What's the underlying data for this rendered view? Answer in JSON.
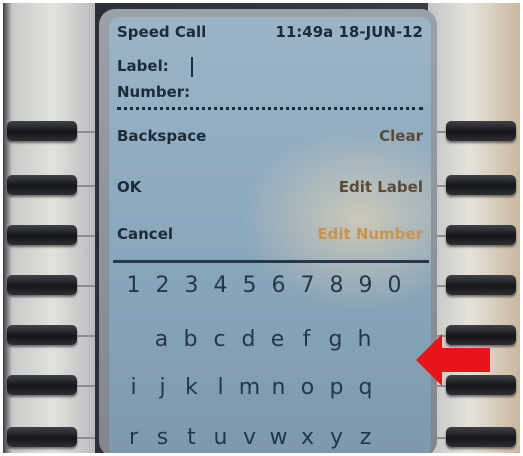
{
  "screen": {
    "title": "Speed Call",
    "clock": "11:49a 18-JUN-12",
    "label_field_name": "Label:",
    "label_value": "",
    "number_field_name": "Number:",
    "number_value": ""
  },
  "softkeys": {
    "backspace": "Backspace",
    "clear": "Clear",
    "ok": "OK",
    "edit_label": "Edit Label",
    "cancel": "Cancel",
    "edit_number": "Edit Number"
  },
  "keypad": {
    "digits": [
      "1",
      "2",
      "3",
      "4",
      "5",
      "6",
      "7",
      "8",
      "9",
      "0"
    ],
    "row_a": [
      "a",
      "b",
      "c",
      "d",
      "e",
      "f",
      "g",
      "h"
    ],
    "row_i": [
      "i",
      "j",
      "k",
      "l",
      "m",
      "n",
      "o",
      "p",
      "q"
    ],
    "row_r": [
      "r",
      "s",
      "t",
      "u",
      "v",
      "w",
      "x",
      "y",
      "z"
    ]
  },
  "colors": {
    "lcd": "#8eaabf",
    "lcd_text": "#1c2b38",
    "annotation_arrow": "#e8141b"
  },
  "icons": {
    "annotation": "red-arrow-left-icon"
  }
}
